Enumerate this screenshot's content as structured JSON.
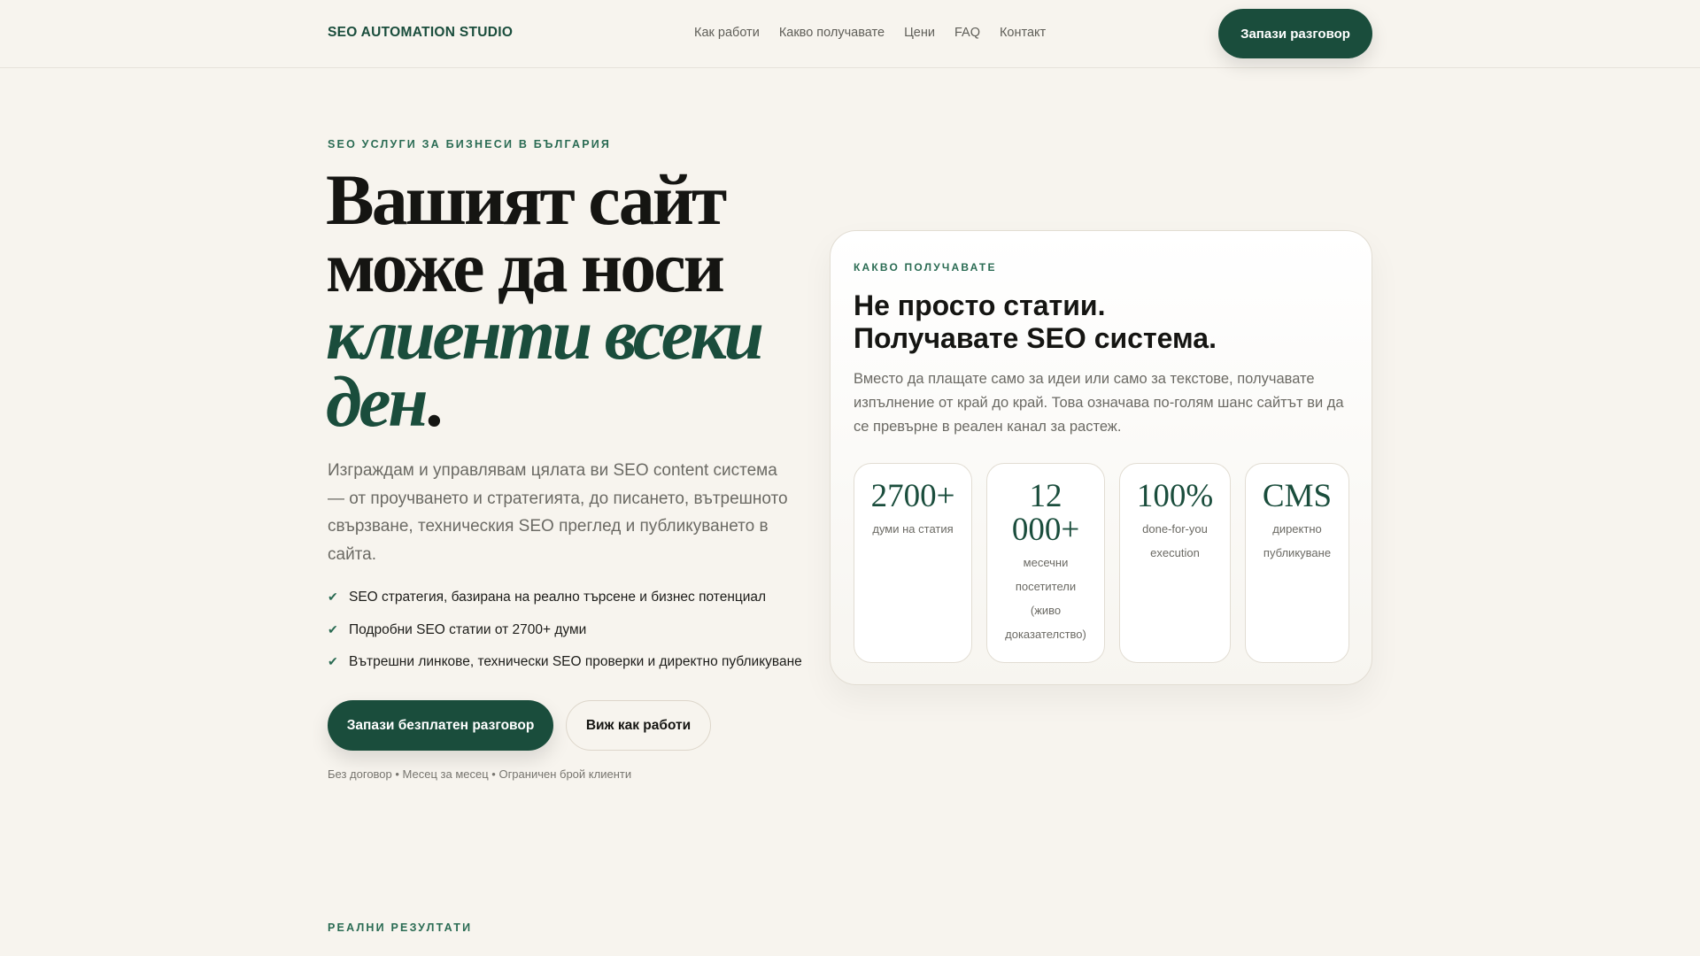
{
  "nav": {
    "logo": "SEO AUTOMATION STUDIO",
    "links": [
      "Как работи",
      "Какво получавате",
      "Цени",
      "FAQ",
      "Контакт"
    ],
    "cta": "Запази разговор"
  },
  "hero": {
    "eyebrow": "SEO УСЛУГИ ЗА БИЗНЕСИ В БЪЛГАРИЯ",
    "title_line1": "Вашият сайт",
    "title_line2": "може да носи",
    "title_accent": "клиенти всеки ден",
    "title_end": ".",
    "lead": "Изграждам и управлявам цялата ви SEO content система — от проучването и стратегията, до писането, вътрешното свързване, техническия SEO преглед и публикуването в сайта.",
    "checks": [
      "SEO стратегия, базирана на реално търсене и бизнес потенциал",
      "Подробни SEO статии от 2700+ думи",
      "Вътрешни линкове, технически SEO проверки и директно публикуване"
    ],
    "primary_cta": "Запази безплатен разговор",
    "secondary_cta": "Виж как работи",
    "note": "Без договор • Месец за месец • Ограничен брой клиенти"
  },
  "card": {
    "eyebrow": "КАКВО ПОЛУЧАВАТЕ",
    "title_line1": "Не просто статии.",
    "title_line2": "Получавате SEO система.",
    "text": "Вместо да плащате само за идеи или само за текстове, получавате изпълнение от край до край. Това означава по-голям шанс сайтът ви да се превърне в реален канал за растеж.",
    "stats": [
      {
        "value": "2700+",
        "label": "думи на статия"
      },
      {
        "value": "12 000+",
        "label": "месечни посетители (живо доказателство)"
      },
      {
        "value": "100%",
        "label": "done-for-you execution"
      },
      {
        "value": "CMS",
        "label": "директно публикуване"
      }
    ]
  },
  "results": {
    "eyebrow": "РЕАЛНИ РЕЗУЛТАТИ"
  },
  "colors": {
    "brand": "#1a4d3c",
    "background": "#f7f4ee"
  }
}
